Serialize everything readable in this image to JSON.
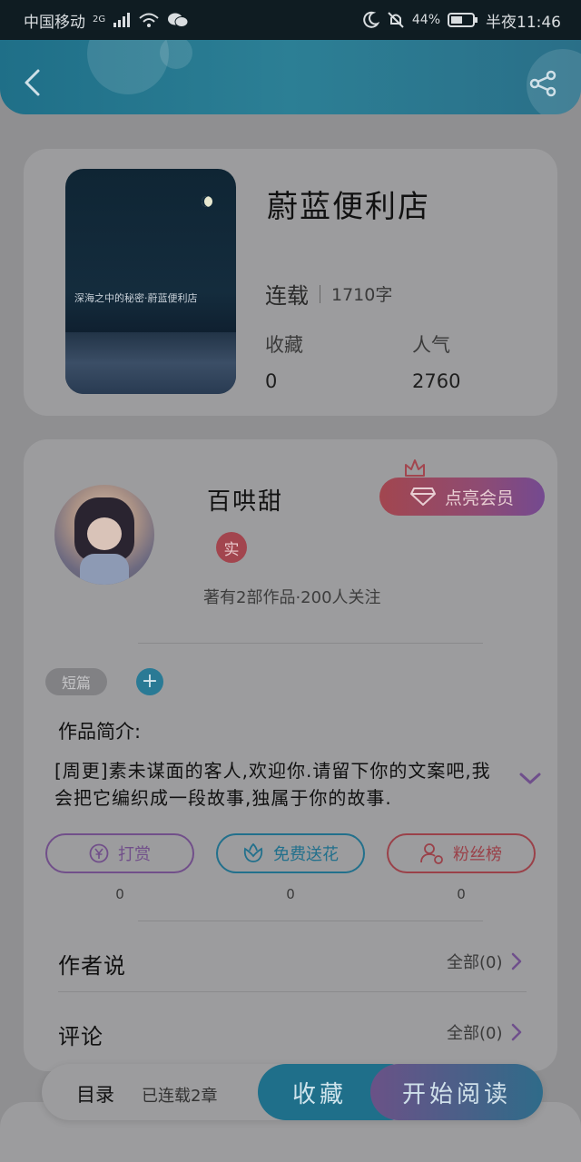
{
  "status_bar": {
    "carrier": "中国移动",
    "network": "2G",
    "battery": "44%",
    "time": "半夜11:46"
  },
  "header": {
    "back_icon": "chevron-left-icon",
    "share_icon": "share-icon"
  },
  "book": {
    "cover_text": "深海之中的秘密·蔚蓝便利店",
    "title": "蔚蓝便利店",
    "status": "连载",
    "word_count": "1710字",
    "favorites_label": "收藏",
    "favorites_value": "0",
    "popularity_label": "人气",
    "popularity_value": "2760"
  },
  "author": {
    "name": "百哄甜",
    "badge": "实",
    "meta": "著有2部作品·200人关注",
    "vip_button": "点亮会员"
  },
  "tags": {
    "chip": "短篇",
    "add": "+"
  },
  "intro": {
    "title": "作品简介:",
    "text": "[周更]素未谋面的客人,欢迎你.请留下你的文案吧,我会把它编织成一段故事,独属于你的故事."
  },
  "actions": [
    {
      "label": "打赏",
      "count": "0",
      "icon": "yen-icon"
    },
    {
      "label": "免费送花",
      "count": "0",
      "icon": "flower-icon"
    },
    {
      "label": "粉丝榜",
      "count": "0",
      "icon": "user-rank-icon"
    }
  ],
  "rows": {
    "author_says": {
      "title": "作者说",
      "right": "全部(0)"
    },
    "comments": {
      "title": "评论",
      "right": "全部(0)"
    }
  },
  "bottom_bar": {
    "toc": "目录",
    "chapters": "已连载2章",
    "collect": "收藏",
    "read": "开始阅读"
  },
  "colors": {
    "header": "#2c7f95",
    "vip": "#a2464f",
    "reward": "#714f8a",
    "flower": "#22708c",
    "fans": "#9a4149"
  }
}
